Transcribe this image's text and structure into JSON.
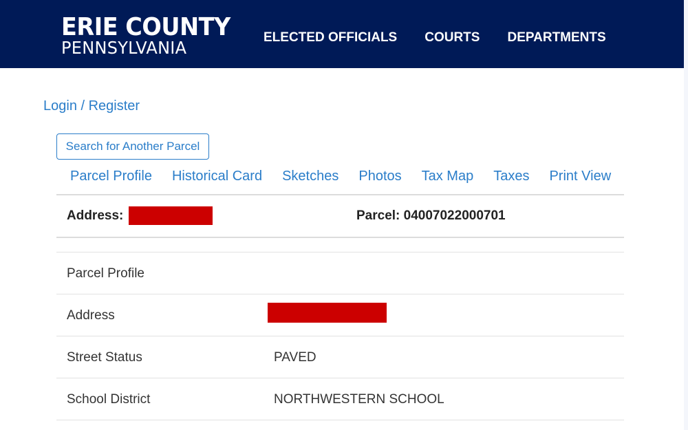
{
  "header": {
    "logo_line1": "ERIE COUNTY",
    "logo_line2": "PENNSYLVANIA",
    "nav": [
      "ELECTED OFFICIALS",
      "COURTS",
      "DEPARTMENTS"
    ],
    "background_color": "#001a57"
  },
  "account": {
    "login_label": "Login / Register"
  },
  "actions": {
    "search_another_label": "Search for Another Parcel"
  },
  "tabs": [
    "Parcel Profile",
    "Historical Card",
    "Sketches",
    "Photos",
    "Tax Map",
    "Taxes",
    "Print View"
  ],
  "summary": {
    "address_label": "Address:",
    "address_value": "[redacted]",
    "parcel_label": "Parcel:",
    "parcel_number": "04007022000701",
    "parcel_text": "Parcel: 04007022000701"
  },
  "profile": {
    "section_title": "Parcel Profile",
    "rows": [
      {
        "label": "Address",
        "value": "[redacted]"
      },
      {
        "label": "Street Status",
        "value": "PAVED"
      },
      {
        "label": "School District",
        "value": "NORTHWESTERN SCHOOL"
      }
    ]
  },
  "colors": {
    "link": "#2a7dc9",
    "redaction": "#cc0000"
  }
}
